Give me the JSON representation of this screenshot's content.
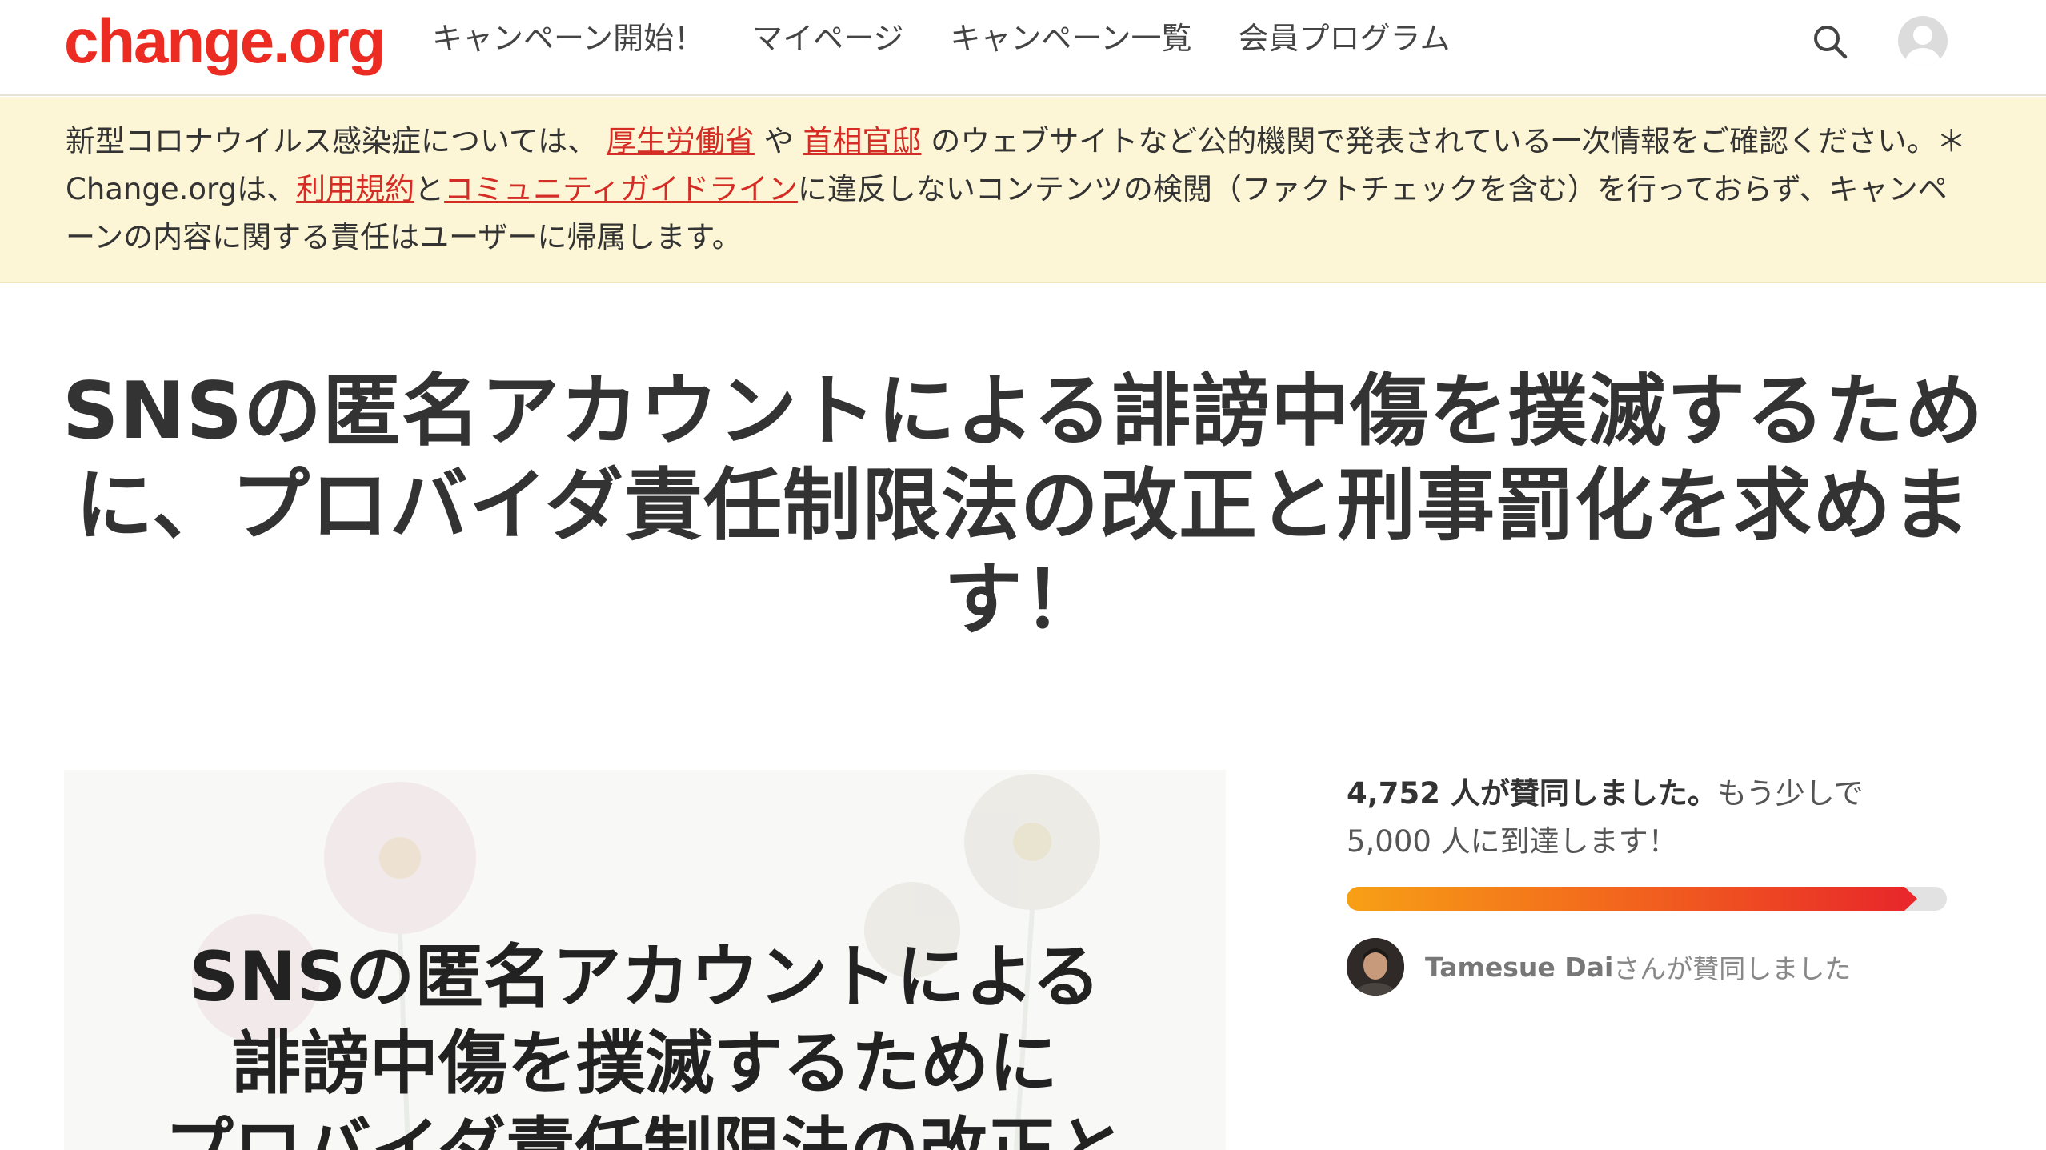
{
  "header": {
    "logo": "change.org",
    "nav": [
      {
        "label": "キャンペーン開始！"
      },
      {
        "label": "マイページ"
      },
      {
        "label": "キャンペーン一覧"
      },
      {
        "label": "会員プログラム"
      }
    ],
    "icons": {
      "search": "search-icon",
      "profile": "avatar-icon"
    }
  },
  "notice": {
    "part1": "新型コロナウイルス感染症については、",
    "link1": "厚生労働省",
    "part2": "や",
    "link2": "首相官邸",
    "part3": "のウェブサイトなど公的機関で発表されている一次情報をご確認ください。＊Change.orgは、",
    "link3": "利用規約",
    "part4": "と",
    "link4": "コミュニティガイドライン",
    "part5": "に違反しないコンテンツの検閲（ファクトチェックを含む）を行っておらず、キャンペーンの内容に関する責任はユーザーに帰属します。"
  },
  "campaign": {
    "title": "SNSの匿名アカウントによる誹謗中傷を撲滅するために、プロバイダ責任制限法の改正と刑事罰化を求めます！",
    "image_text": "SNSの匿名アカウントによる\n誹謗中傷を撲滅するために\nプロバイダ責任制限法の改正と"
  },
  "progress": {
    "count_text": "4,752 人が賛同しました。",
    "remaining_text": "もう少しで",
    "goal_text": "5,000 人に到達します！",
    "signed": 4752,
    "goal": 5000
  },
  "supporter": {
    "name": "Tamesue Dai",
    "action": "さんが賛同しました"
  },
  "colors": {
    "brand": "#ec2c22",
    "link": "#d42d25",
    "notice_bg": "#fdf6d6"
  }
}
